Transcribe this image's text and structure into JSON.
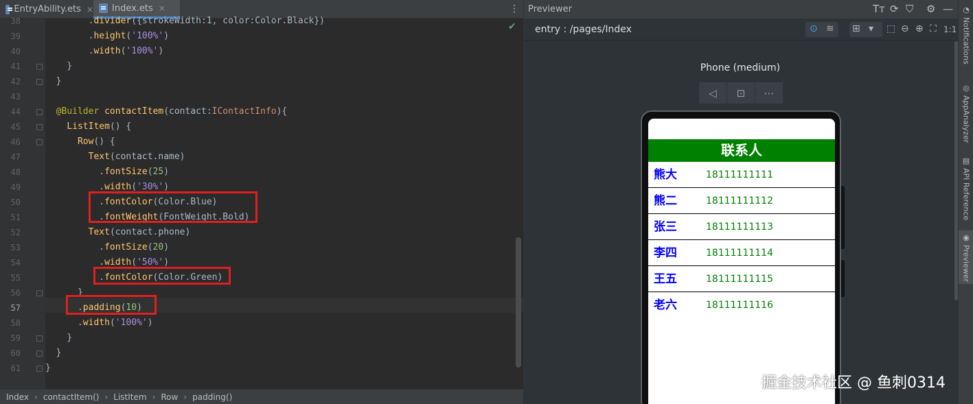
{
  "editor": {
    "tabs": [
      {
        "label": "EntryAbility.ets",
        "close": "×"
      },
      {
        "label": "Index.ets",
        "close": "×"
      }
    ],
    "menu_icon": "⋮",
    "status_check": "✔",
    "current_line": "57",
    "lines": [
      {
        "num": "38",
        "text": "        .divider({strokeWidth:1, color:Color.Black})"
      },
      {
        "num": "39",
        "text": "        .height('100%')"
      },
      {
        "num": "40",
        "text": "        .width('100%')"
      },
      {
        "num": "41",
        "text": "    }"
      },
      {
        "num": "42",
        "text": "  }"
      },
      {
        "num": "43",
        "text": ""
      },
      {
        "num": "44",
        "text": "  @Builder contactItem(contact:IContactInfo){"
      },
      {
        "num": "45",
        "text": "    ListItem() {"
      },
      {
        "num": "46",
        "text": "      Row() {"
      },
      {
        "num": "47",
        "text": "        Text(contact.name)"
      },
      {
        "num": "48",
        "text": "          .fontSize(25)"
      },
      {
        "num": "49",
        "text": "          .width('30%')"
      },
      {
        "num": "50",
        "text": "          .fontColor(Color.Blue)"
      },
      {
        "num": "51",
        "text": "          .fontWeight(FontWeight.Bold)"
      },
      {
        "num": "52",
        "text": "        Text(contact.phone)"
      },
      {
        "num": "53",
        "text": "          .fontSize(20)"
      },
      {
        "num": "54",
        "text": "          .width('50%')"
      },
      {
        "num": "55",
        "text": "          .fontColor(Color.Green)"
      },
      {
        "num": "56",
        "text": "      }"
      },
      {
        "num": "57",
        "text": "      .padding(10)"
      },
      {
        "num": "58",
        "text": "      .width('100%')"
      },
      {
        "num": "59",
        "text": "    }"
      },
      {
        "num": "60",
        "text": "  }"
      },
      {
        "num": "61",
        "text": "}"
      }
    ]
  },
  "breadcrumb": [
    "Index",
    "contactItem()",
    "ListItem",
    "Row",
    "padding()"
  ],
  "previewer": {
    "title": "Previewer",
    "route": "entry : /pages/Index",
    "device_label": "Phone (medium)",
    "device_controls": [
      "◁",
      "⊡",
      "⋯"
    ],
    "header_icons": [
      "Tт",
      "⟳",
      "⛉",
      "⚙",
      "—"
    ],
    "toolbar_icons": [
      "⊙",
      "≋",
      "⊞",
      "▾",
      "⬚",
      "⊖",
      "⊕",
      "⛶",
      "1:1"
    ],
    "app": {
      "title": "联系人",
      "title_bg": "#008000",
      "contacts": [
        {
          "name": "熊大",
          "phone": "18111111111"
        },
        {
          "name": "熊二",
          "phone": "18111111112"
        },
        {
          "name": "张三",
          "phone": "18111111113"
        },
        {
          "name": "李四",
          "phone": "18111111114"
        },
        {
          "name": "王五",
          "phone": "18111111115"
        },
        {
          "name": "老六",
          "phone": "18111111116"
        }
      ],
      "name_color": "#0000ff",
      "phone_color": "#008000"
    }
  },
  "side_tabs": [
    {
      "label": "Notifications",
      "icon": "bell-icon"
    },
    {
      "label": "AppAnalyzer",
      "icon": "analyzer-icon"
    },
    {
      "label": "API Reference",
      "icon": "book-icon"
    },
    {
      "label": "Previewer",
      "icon": "eye-icon"
    }
  ],
  "watermark": "掘金技术社区 @ 鱼刺0314"
}
